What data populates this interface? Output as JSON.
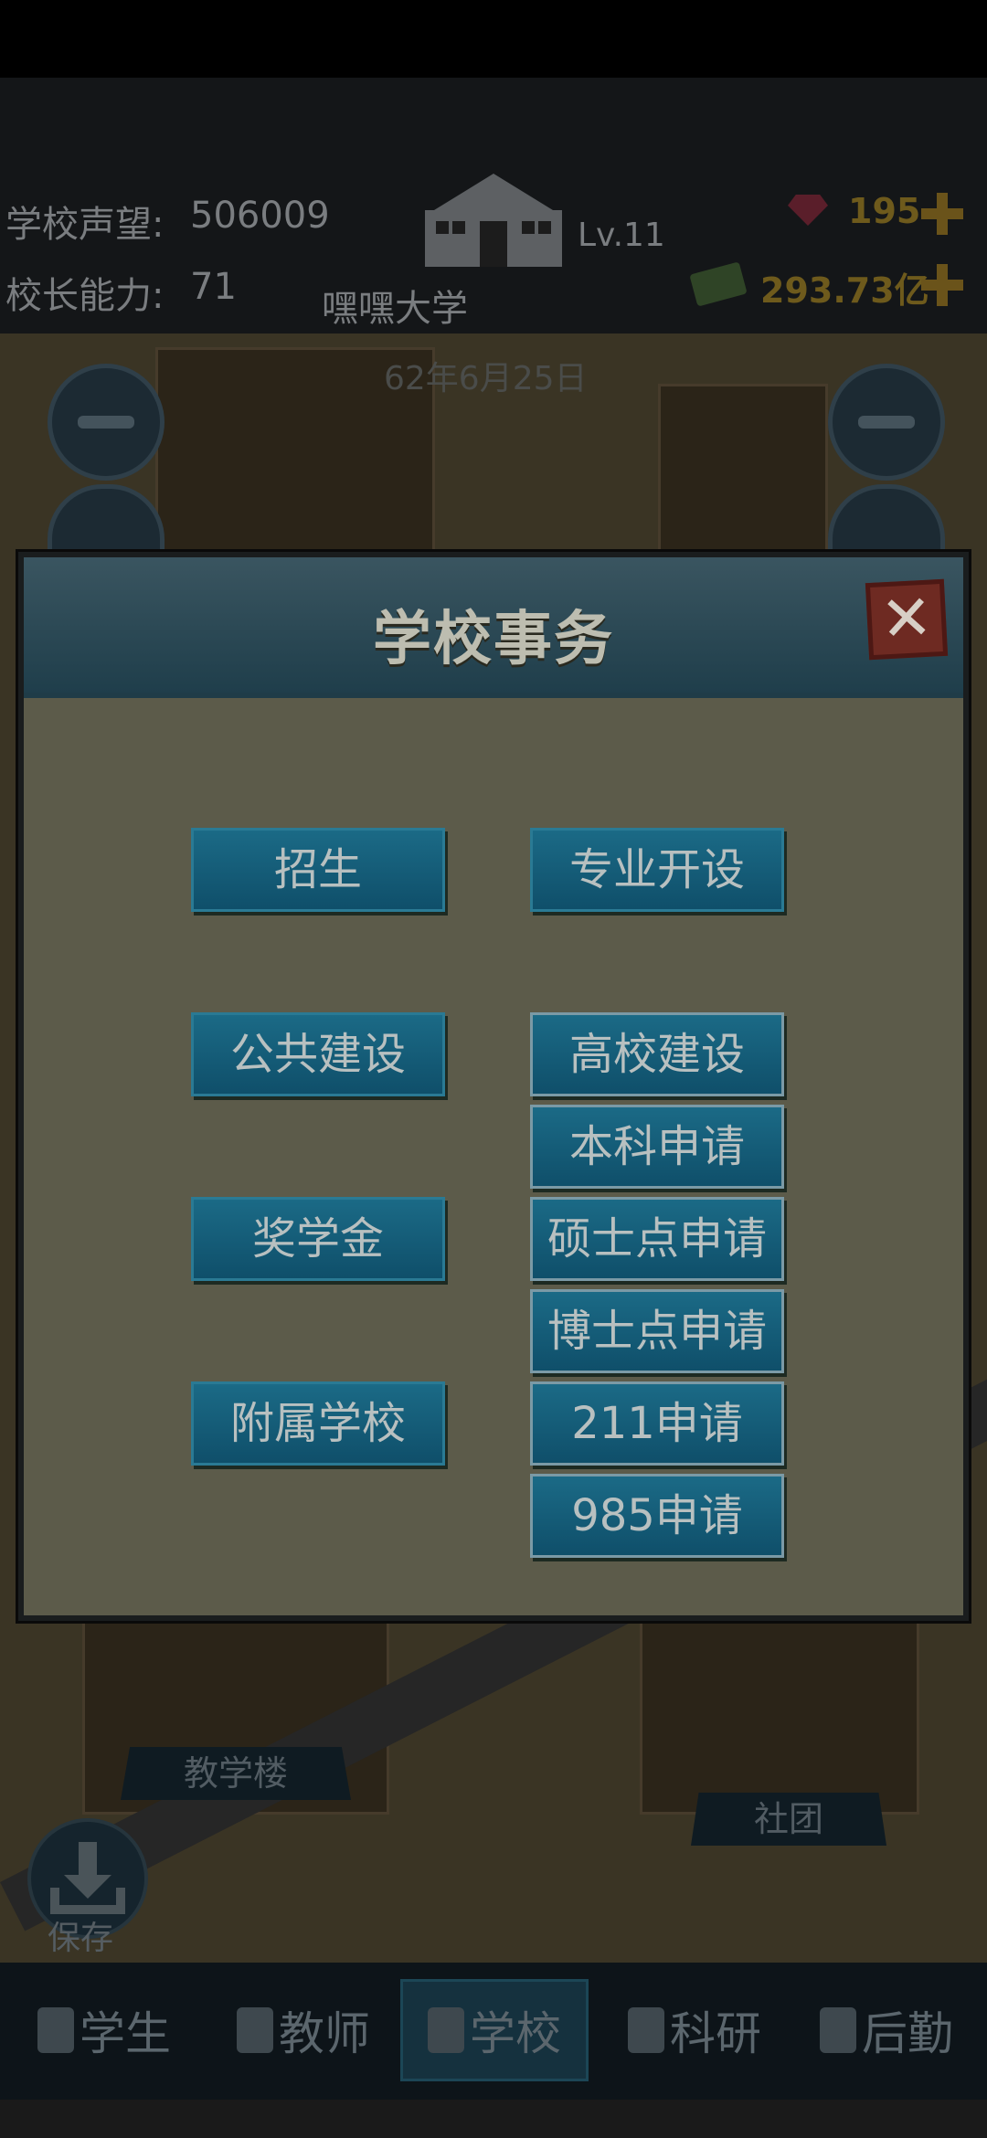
{
  "hud": {
    "reputation_label": "学校声望:",
    "reputation_value": "506009",
    "principal_label": "校长能力:",
    "principal_value": "71",
    "school_level": "Lv.11",
    "school_name": "嘿嘿大学",
    "date": "62年6月25日",
    "gems": "195",
    "money": "293.73亿"
  },
  "scene_labels": {
    "teaching_building": "教学楼",
    "club": "社团",
    "save": "保存"
  },
  "modal": {
    "title": "学校事务",
    "close_icon": "close-x-icon",
    "buttons": {
      "enrollment": "招生",
      "major_setup": "专业开设",
      "public_construction": "公共建设",
      "university_construction": "高校建设",
      "undergrad_application": "本科申请",
      "scholarship": "奖学金",
      "master_application": "硕士点申请",
      "doctoral_application": "博士点申请",
      "affiliated_school": "附属学校",
      "apply_211": "211申请",
      "apply_985": "985申请"
    }
  },
  "nav": {
    "students": "学生",
    "teachers": "教师",
    "school": "学校",
    "research": "科研",
    "logistics": "后勤"
  },
  "colors": {
    "button_blue": "#1b6a86",
    "modal_body": "#5c5b4a",
    "close_red": "#6e2a22"
  }
}
